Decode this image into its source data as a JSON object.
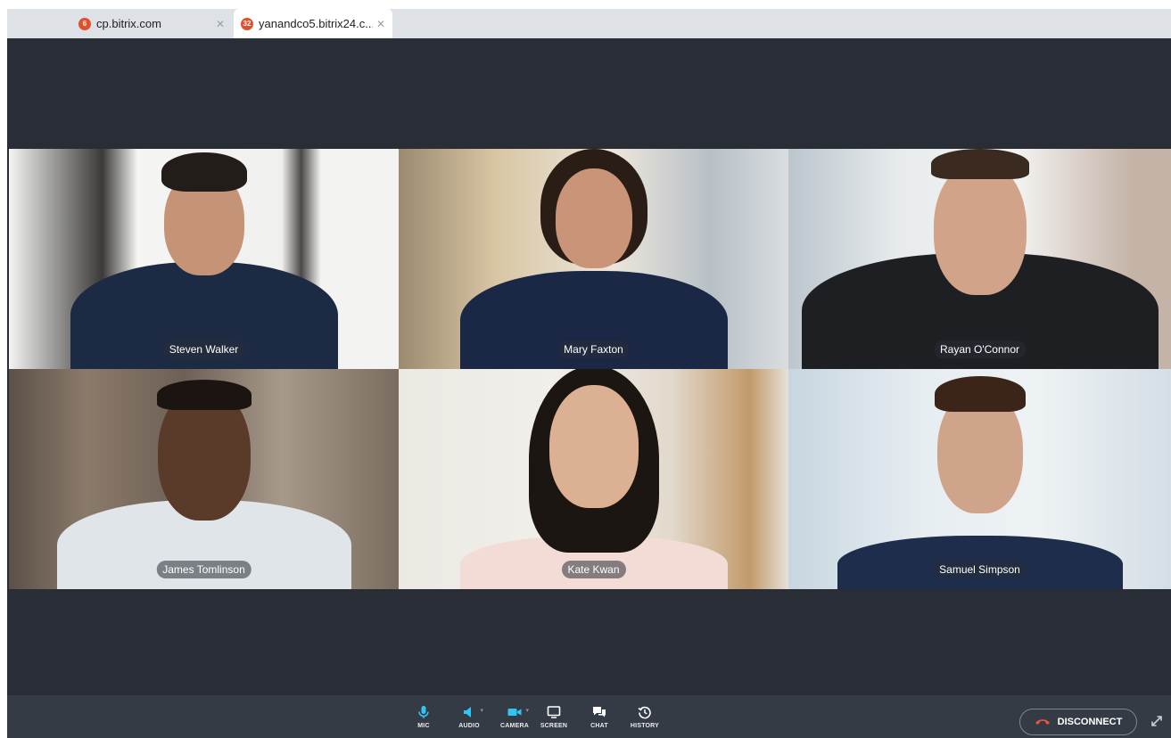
{
  "browser": {
    "tabs": [
      {
        "title": "cp.bitrix.com",
        "badge": "6",
        "active": false
      },
      {
        "title": "yanandco5.bitrix24.c...",
        "badge": "32",
        "active": true
      }
    ]
  },
  "call": {
    "participants": [
      {
        "name": "Steven Walker"
      },
      {
        "name": "Mary Faxton"
      },
      {
        "name": "Rayan O'Connor"
      },
      {
        "name": "James Tomlinson"
      },
      {
        "name": "Kate Kwan"
      },
      {
        "name": "Samuel Simpson"
      }
    ]
  },
  "controls": {
    "mic": "MIC",
    "audio": "AUDIO",
    "camera": "CAMERA",
    "screen": "SCREEN",
    "chat": "CHAT",
    "history": "HISTORY",
    "disconnect": "DISCONNECT"
  },
  "colors": {
    "stage_bg": "#282d36",
    "control_bg": "#353b45",
    "accent_blue": "#2fc6f6",
    "badge": "#e0512b",
    "disconnect_icon": "#f0553e"
  }
}
